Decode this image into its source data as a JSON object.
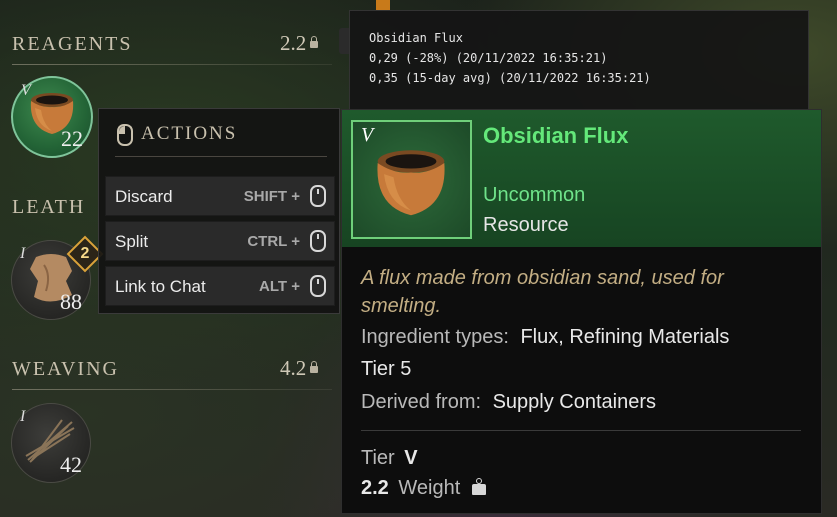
{
  "sections": {
    "reagents": {
      "title": "REAGENTS",
      "weight": "2.2"
    },
    "leather": {
      "title": "LEATH"
    },
    "weaving": {
      "title": "WEAVING",
      "weight": "4.2"
    }
  },
  "slots": {
    "flux": {
      "tier": "V",
      "count": "22"
    },
    "leather": {
      "tier": "I",
      "count": "88",
      "badge": "2"
    },
    "fiber": {
      "tier": "I",
      "count": "42"
    }
  },
  "actions": {
    "title": "ACTIONS",
    "items": [
      {
        "label": "Discard",
        "key": "SHIFT +"
      },
      {
        "label": "Split",
        "key": "CTRL +"
      },
      {
        "label": "Link to Chat",
        "key": "ALT +"
      }
    ]
  },
  "price": {
    "name": "Obsidian Flux",
    "line1": "0,29 (-28%) (20/11/2022 16:35:21)",
    "line2": "0,35 (15-day avg) (20/11/2022 16:35:21)"
  },
  "item": {
    "tier_mark": "V",
    "name": "Obsidian Flux",
    "rarity": "Uncommon",
    "type": "Resource",
    "description": "A flux made from obsidian sand, used for smelting.",
    "ingredient_label": "Ingredient types:",
    "ingredient_value": "Flux, Refining Materials",
    "tier_line": "Tier 5",
    "derived_label": "Derived from:",
    "derived_value": "Supply Containers",
    "tier_label": "Tier",
    "tier_value": "V",
    "weight_value": "2.2",
    "weight_label": "Weight"
  },
  "colors": {
    "item_name": "#64e87a",
    "rarity": "#6fe38a",
    "description": "#c3ae84",
    "header_bg": "#1f5a2c"
  },
  "icons": [
    "lock-icon",
    "mouse-icon",
    "weight-icon",
    "flux-pot-icon",
    "leather-hide-icon",
    "fiber-bundle-icon"
  ]
}
